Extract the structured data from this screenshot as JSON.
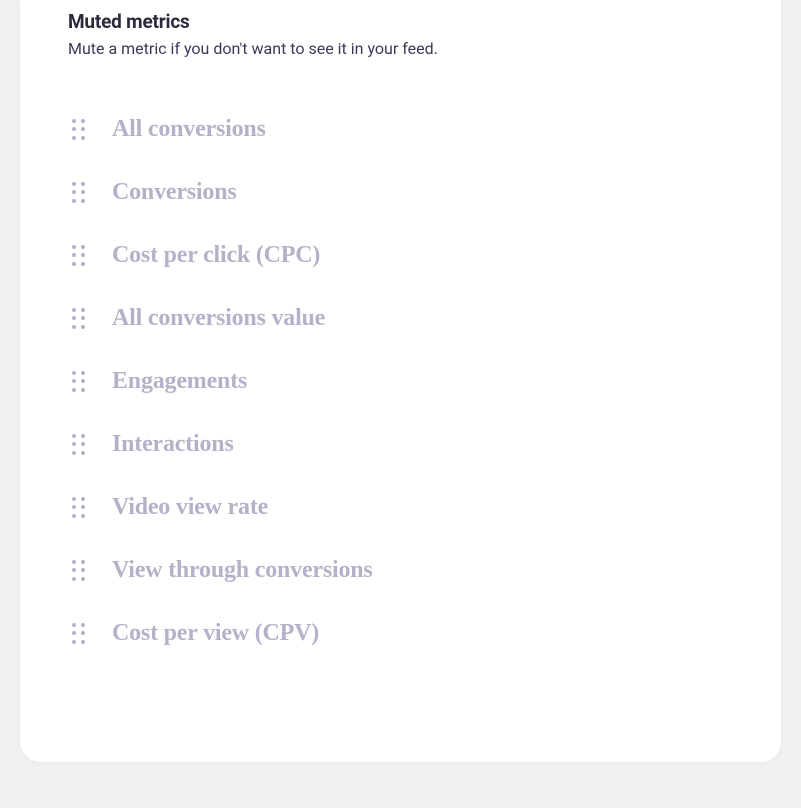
{
  "muted_metrics": {
    "title": "Muted metrics",
    "subtitle": "Mute a metric if you don't want to see it in your feed.",
    "items": [
      {
        "label": "All conversions"
      },
      {
        "label": "Conversions"
      },
      {
        "label": "Cost per click (CPC)"
      },
      {
        "label": "All conversions value"
      },
      {
        "label": "Engagements"
      },
      {
        "label": "Interactions"
      },
      {
        "label": "Video view rate"
      },
      {
        "label": "View through conversions"
      },
      {
        "label": "Cost per view (CPV)"
      }
    ]
  }
}
